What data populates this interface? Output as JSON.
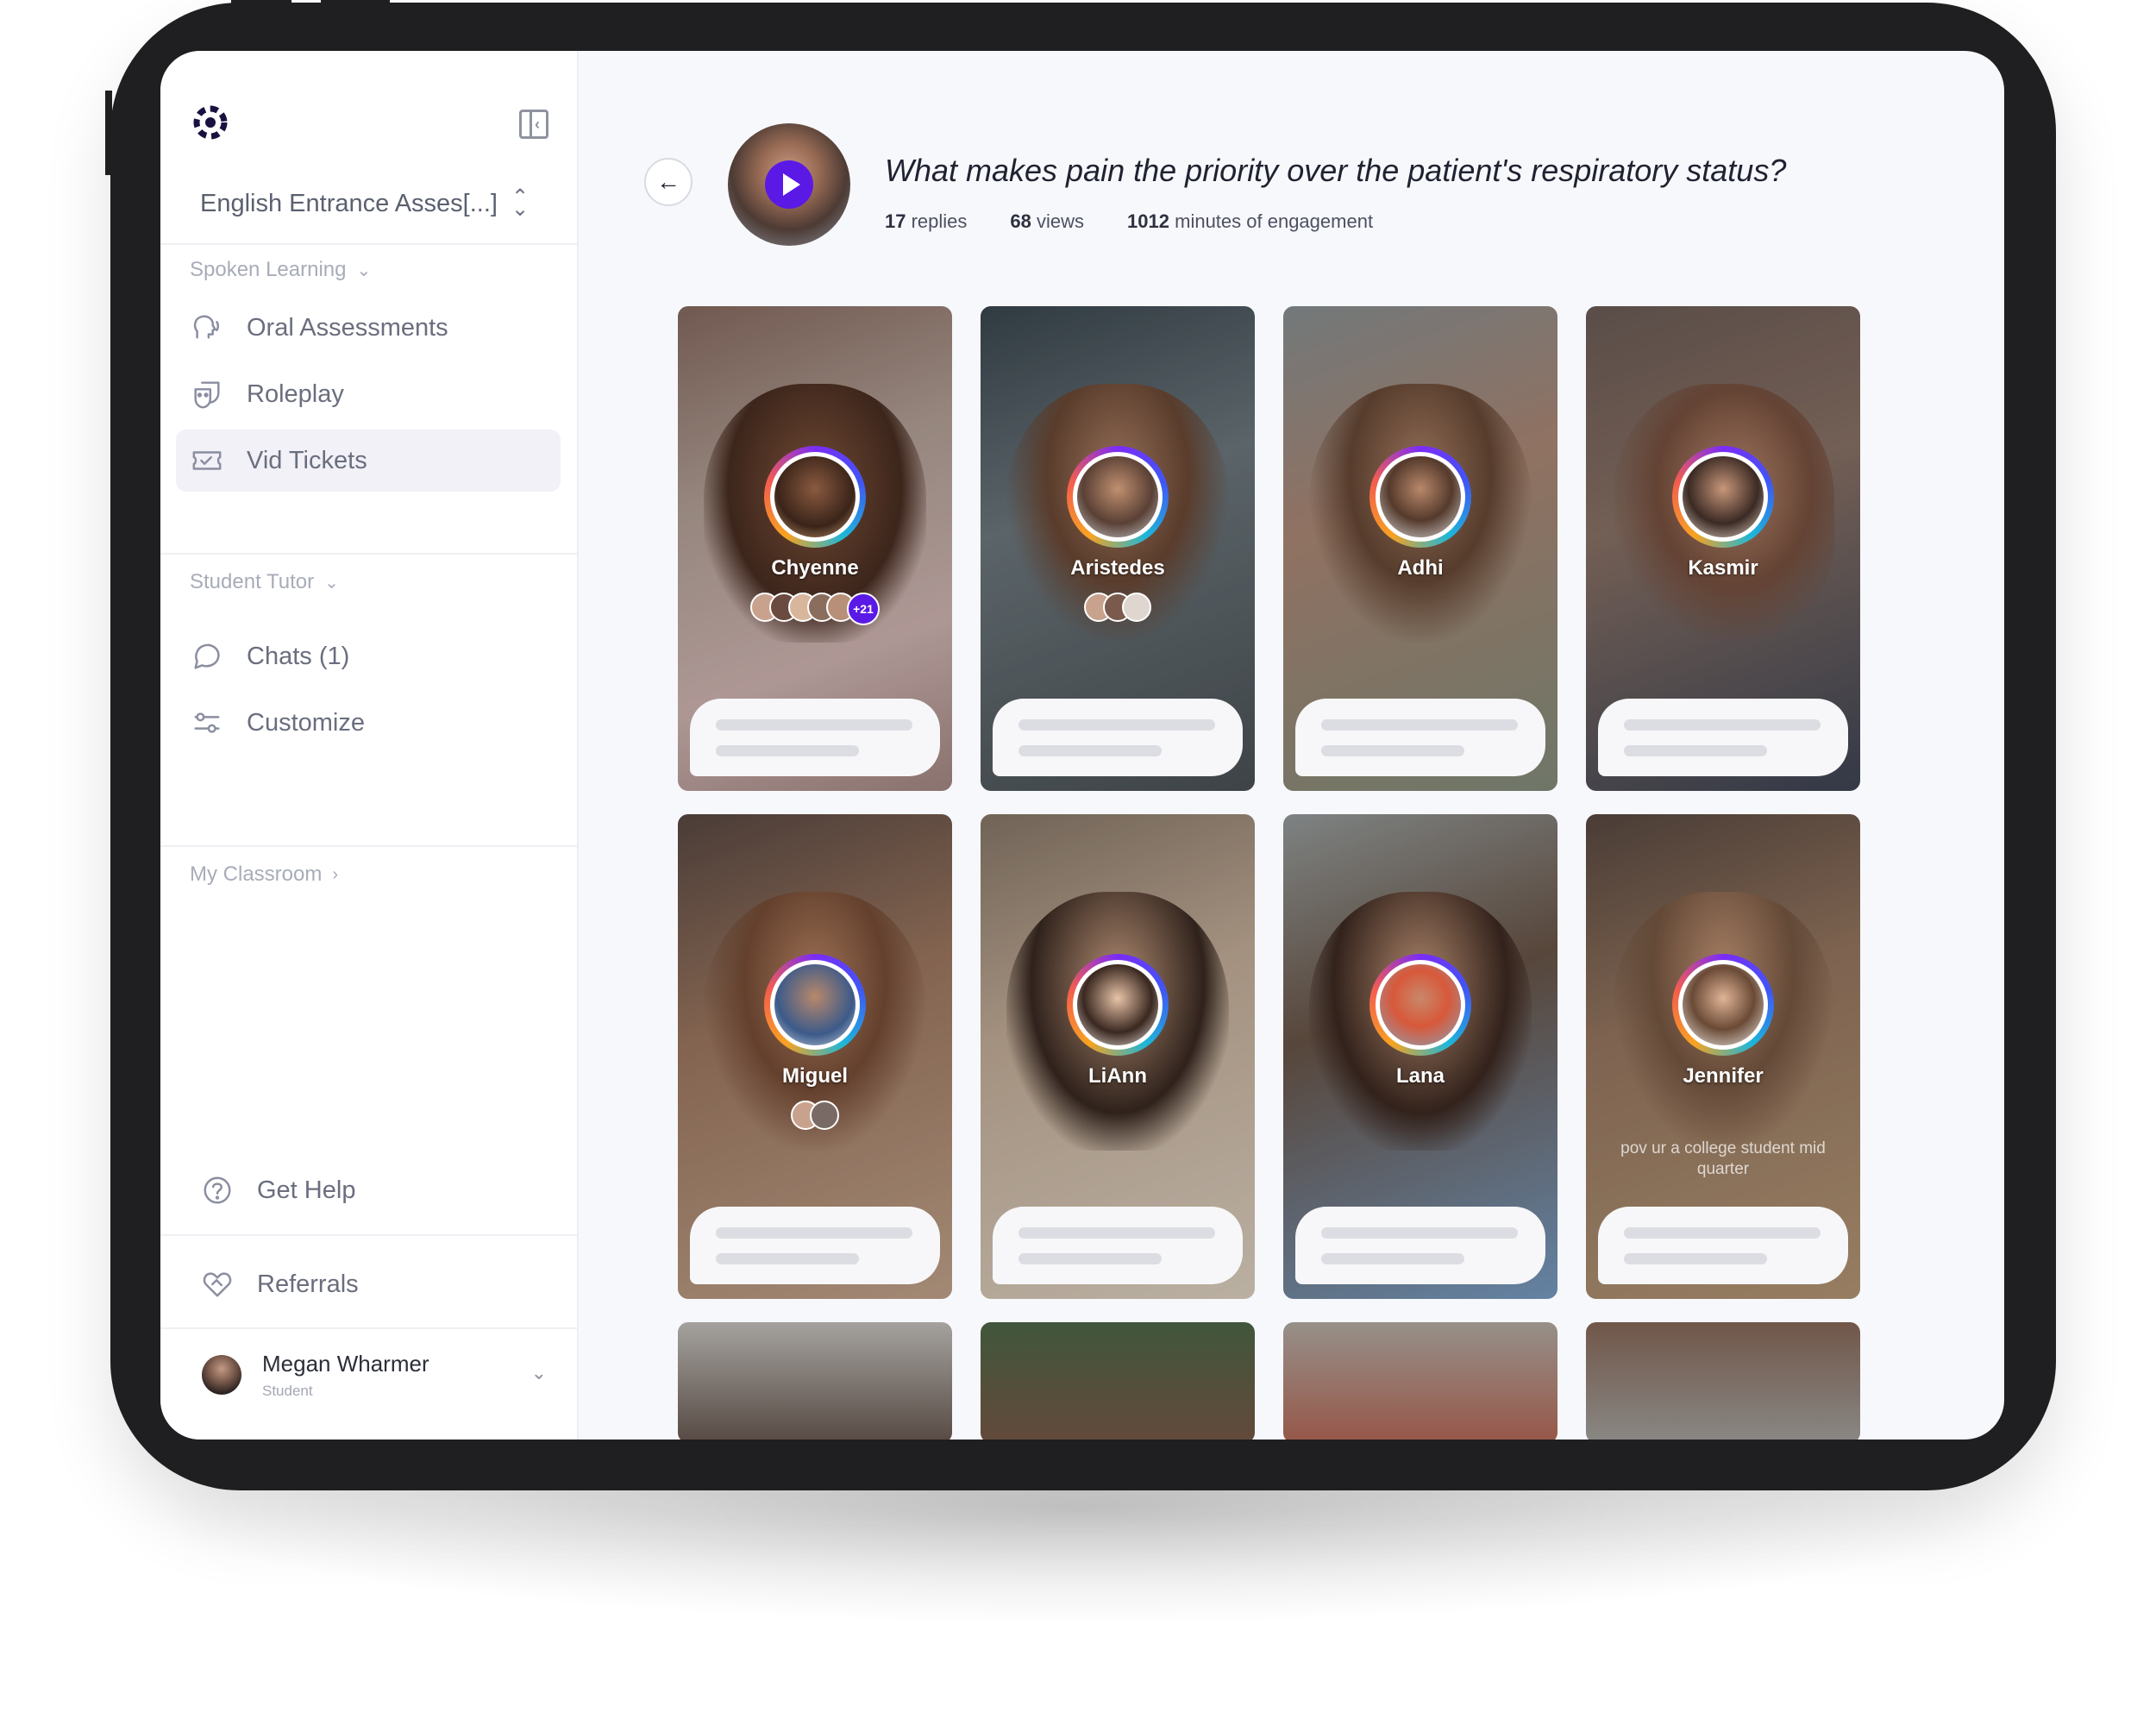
{
  "sidebar": {
    "course_title": "English Entrance Asses[...]",
    "sections": {
      "spoken_learning": "Spoken Learning",
      "student_tutor": "Student Tutor",
      "my_classroom": "My Classroom"
    },
    "items": [
      {
        "label": "Oral Assessments",
        "icon": "speaking-head-icon"
      },
      {
        "label": "Roleplay",
        "icon": "masks-icon"
      },
      {
        "label": "Vid Tickets",
        "icon": "ticket-icon",
        "active": true
      },
      {
        "label": "Chats (1)",
        "icon": "chat-bubble-icon"
      },
      {
        "label": "Customize",
        "icon": "sliders-icon"
      }
    ],
    "help_label": "Get Help",
    "referrals_label": "Referrals",
    "user": {
      "name": "Megan Wharmer",
      "role": "Student"
    }
  },
  "question": {
    "title": "What makes pain the priority over the patient's respiratory status?",
    "replies_count": "17",
    "replies_label": "replies",
    "views_count": "68",
    "views_label": "views",
    "engagement_count": "1012",
    "engagement_label": "minutes of engagement"
  },
  "responses": [
    {
      "name": "Chyenne",
      "reactions_more": "+21"
    },
    {
      "name": "Aristedes"
    },
    {
      "name": "Adhi"
    },
    {
      "name": "Kasmir"
    },
    {
      "name": "Miguel"
    },
    {
      "name": "LiAnn"
    },
    {
      "name": "Lana"
    },
    {
      "name": "Jennifer",
      "caption": "pov ur a college student mid quarter"
    }
  ],
  "colors": {
    "accent": "#5b19e6",
    "device_frame": "#1f1e20",
    "active_nav_bg": "#f1f1f7"
  }
}
